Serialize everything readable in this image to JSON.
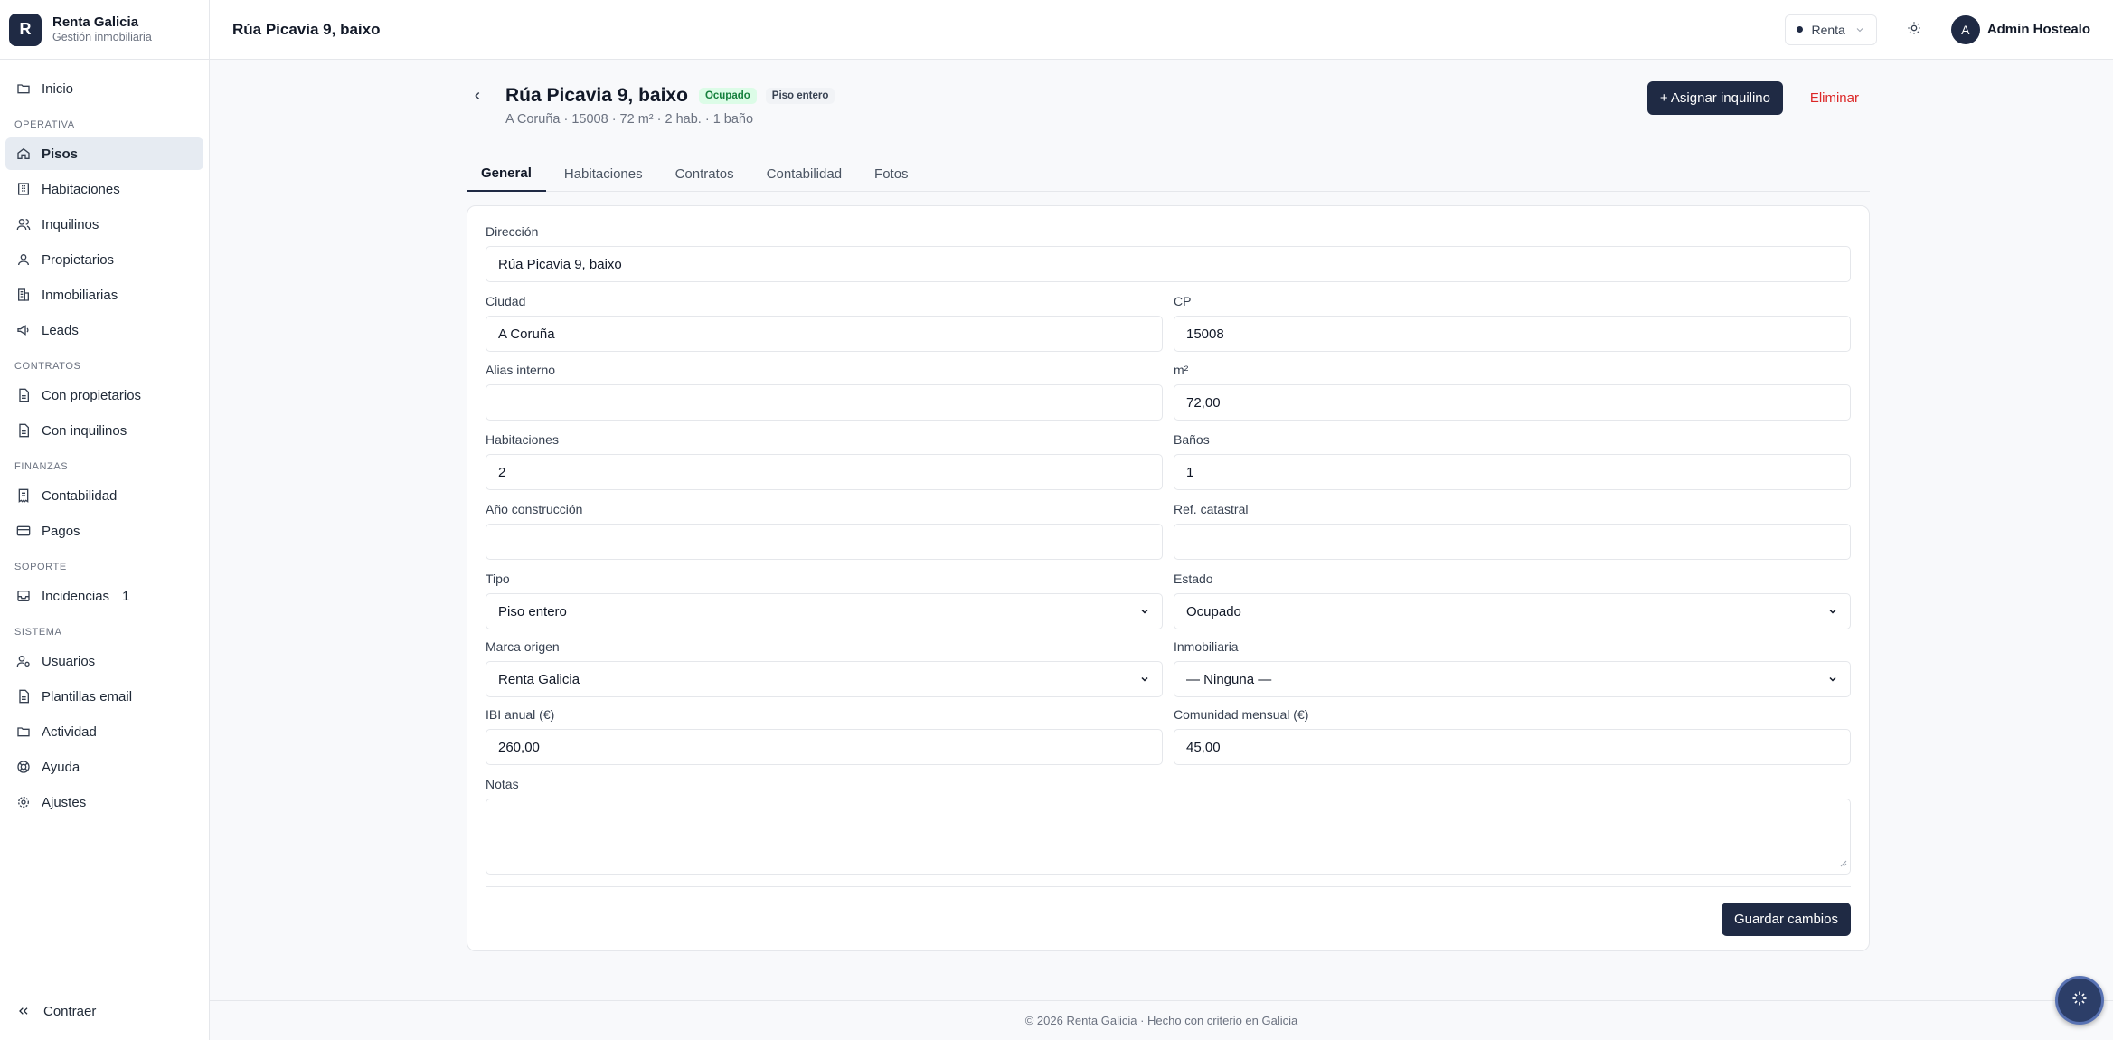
{
  "brand": {
    "logo_letter": "R",
    "name": "Renta Galicia",
    "subtitle": "Gestión inmobiliaria"
  },
  "sidebar": {
    "home": {
      "label": "Inicio",
      "icon": "folder-icon"
    },
    "sections": [
      {
        "title": "OPERATIVA",
        "items": [
          {
            "label": "Pisos",
            "icon": "home-icon",
            "active": true
          },
          {
            "label": "Habitaciones",
            "icon": "building-icon"
          },
          {
            "label": "Inquilinos",
            "icon": "users-icon"
          },
          {
            "label": "Propietarios",
            "icon": "user-icon"
          },
          {
            "label": "Inmobiliarias",
            "icon": "office-icon"
          },
          {
            "label": "Leads",
            "icon": "megaphone-icon"
          }
        ]
      },
      {
        "title": "CONTRATOS",
        "items": [
          {
            "label": "Con propietarios",
            "icon": "document-icon"
          },
          {
            "label": "Con inquilinos",
            "icon": "document-icon"
          }
        ]
      },
      {
        "title": "FINANZAS",
        "items": [
          {
            "label": "Contabilidad",
            "icon": "receipt-icon"
          },
          {
            "label": "Pagos",
            "icon": "credit-card-icon"
          }
        ]
      },
      {
        "title": "SOPORTE",
        "items": [
          {
            "label": "Incidencias",
            "icon": "inbox-icon",
            "count": "1"
          }
        ]
      },
      {
        "title": "SISTEMA",
        "items": [
          {
            "label": "Usuarios",
            "icon": "user-cog-icon"
          },
          {
            "label": "Plantillas email",
            "icon": "document-icon"
          },
          {
            "label": "Actividad",
            "icon": "folder-icon"
          },
          {
            "label": "Ayuda",
            "icon": "lifebuoy-icon"
          },
          {
            "label": "Ajustes",
            "icon": "gear-icon"
          }
        ]
      }
    ],
    "collapse_label": "Contraer"
  },
  "topbar": {
    "title": "Rúa Picavia 9, baixo",
    "brand_select": "Renta",
    "user_initial": "A",
    "user_name": "Admin Hostealo"
  },
  "page": {
    "title": "Rúa Picavia 9, baixo",
    "status_badge": "Ocupado",
    "type_badge": "Piso entero",
    "subtitle": "A Coruña · 15008 · 72 m² · 2 hab. · 1 baño",
    "assign_button": "+ Asignar inquilino",
    "delete_button": "Eliminar",
    "tabs": [
      "General",
      "Habitaciones",
      "Contratos",
      "Contabilidad",
      "Fotos"
    ],
    "active_tab": "General"
  },
  "form": {
    "direccion": {
      "label": "Dirección",
      "value": "Rúa Picavia 9, baixo"
    },
    "ciudad": {
      "label": "Ciudad",
      "value": "A Coruña"
    },
    "cp": {
      "label": "CP",
      "value": "15008"
    },
    "alias": {
      "label": "Alias interno",
      "value": ""
    },
    "m2": {
      "label": "m²",
      "value": "72,00"
    },
    "habitaciones": {
      "label": "Habitaciones",
      "value": "2"
    },
    "banos": {
      "label": "Baños",
      "value": "1"
    },
    "anio": {
      "label": "Año construcción",
      "value": ""
    },
    "catastral": {
      "label": "Ref. catastral",
      "value": ""
    },
    "tipo": {
      "label": "Tipo",
      "value": "Piso entero"
    },
    "estado": {
      "label": "Estado",
      "value": "Ocupado"
    },
    "marca": {
      "label": "Marca origen",
      "value": "Renta Galicia"
    },
    "inmobiliaria": {
      "label": "Inmobiliaria",
      "value": "— Ninguna —"
    },
    "ibi": {
      "label": "IBI anual (€)",
      "value": "260,00"
    },
    "comunidad": {
      "label": "Comunidad mensual (€)",
      "value": "45,00"
    },
    "notas": {
      "label": "Notas",
      "value": ""
    },
    "save_button": "Guardar cambios"
  },
  "footer": {
    "text": "© 2026 Renta Galicia · Hecho con criterio en Galicia"
  },
  "fab": {
    "icon": "sparkle-icon"
  },
  "colors": {
    "primary": "#1f2a44",
    "danger": "#dc2626",
    "success_bg": "#dcfce7",
    "success_text": "#15803d"
  }
}
